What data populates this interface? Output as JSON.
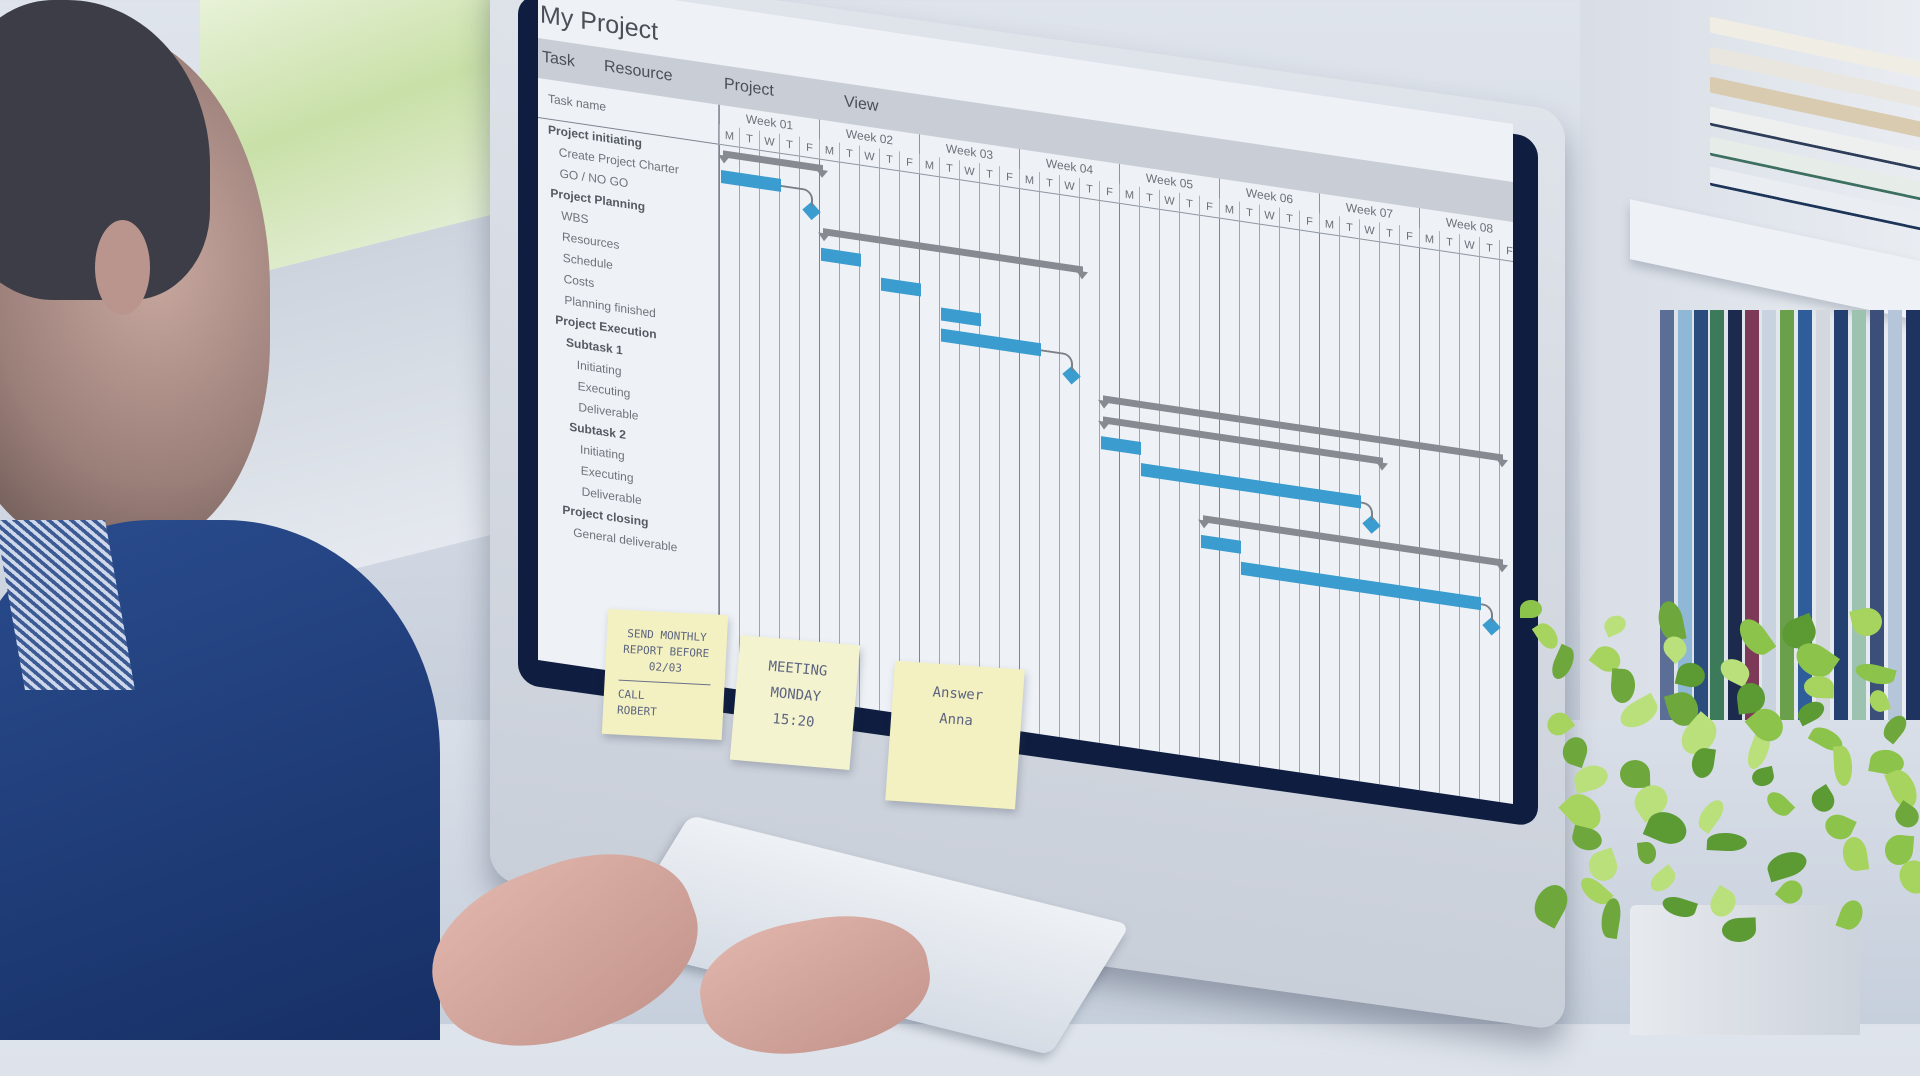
{
  "scene": {
    "description": "Person at desktop computer viewing a Gantt chart project plan",
    "sticky_notes": [
      {
        "lines": [
          "SEND MONTHLY",
          "REPORT BEFORE",
          "02/03"
        ],
        "footer": [
          "CALL",
          "ROBERT"
        ]
      },
      {
        "lines": [
          "MEETING",
          "MONDAY",
          "15:20"
        ],
        "footer": []
      },
      {
        "lines": [
          "Answer",
          "Anna"
        ],
        "footer": []
      }
    ]
  },
  "app": {
    "title": "My Project",
    "menu": [
      "Task",
      "Resource",
      "Project",
      "View"
    ],
    "task_column_header": "Task name",
    "colors": {
      "task_bar": "#3a9ccf",
      "summary_bar": "#878b91",
      "milestone": "#3a9ccf",
      "grid": "#9ea5ae"
    }
  },
  "chart_data": {
    "type": "gantt",
    "title": "My Project",
    "weeks": [
      "Week 01",
      "Week 02",
      "Week 03",
      "Week 04",
      "Week 05",
      "Week 06",
      "Week 07",
      "Week 08"
    ],
    "days": [
      "M",
      "T",
      "W",
      "T",
      "F"
    ],
    "day_unit": "workday index from Week 01 Monday",
    "tasks": [
      {
        "name": "Project initiating",
        "kind": "summary",
        "level": 0,
        "start": 0,
        "end": 5
      },
      {
        "name": "Create Project Charter",
        "kind": "task",
        "level": 1,
        "start": 0,
        "end": 3
      },
      {
        "name": "GO / NO GO",
        "kind": "milestone",
        "level": 1,
        "at": 4.5
      },
      {
        "name": "Project Planning",
        "kind": "summary",
        "level": 0,
        "start": 5,
        "end": 18
      },
      {
        "name": "WBS",
        "kind": "task",
        "level": 1,
        "start": 5,
        "end": 7
      },
      {
        "name": "Resources",
        "kind": "task",
        "level": 1,
        "start": 8,
        "end": 10
      },
      {
        "name": "Schedule",
        "kind": "task",
        "level": 1,
        "start": 11,
        "end": 13
      },
      {
        "name": "Costs",
        "kind": "task",
        "level": 1,
        "start": 11,
        "end": 16
      },
      {
        "name": "Planning finished",
        "kind": "milestone",
        "level": 1,
        "at": 17.5
      },
      {
        "name": "Project Execution",
        "kind": "summary",
        "level": 0,
        "start": 19,
        "end": 39
      },
      {
        "name": "Subtask 1",
        "kind": "summary",
        "level": 1,
        "start": 19,
        "end": 33
      },
      {
        "name": "Initiating",
        "kind": "task",
        "level": 2,
        "start": 19,
        "end": 21
      },
      {
        "name": "Executing",
        "kind": "task",
        "level": 2,
        "start": 21,
        "end": 32
      },
      {
        "name": "Deliverable",
        "kind": "milestone",
        "level": 2,
        "at": 32.5
      },
      {
        "name": "Subtask 2",
        "kind": "summary",
        "level": 1,
        "start": 24,
        "end": 39
      },
      {
        "name": "Initiating",
        "kind": "task",
        "level": 2,
        "start": 24,
        "end": 26
      },
      {
        "name": "Executing",
        "kind": "task",
        "level": 2,
        "start": 26,
        "end": 38
      },
      {
        "name": "Deliverable",
        "kind": "milestone",
        "level": 2,
        "at": 38.5
      },
      {
        "name": "Project closing",
        "kind": "summary",
        "level": 0
      },
      {
        "name": "General deliverable",
        "kind": "milestone",
        "level": 1
      }
    ]
  }
}
